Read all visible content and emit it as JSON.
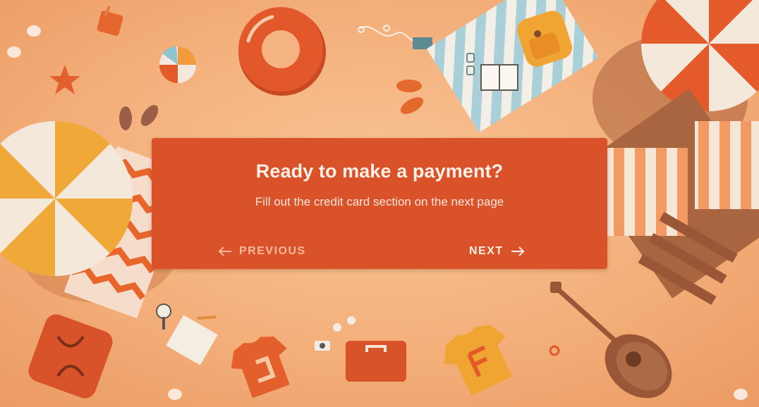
{
  "dialog": {
    "title": "Ready to make a payment?",
    "subtitle": "Fill out the credit card section on the next page",
    "previous_label": "PREVIOUS",
    "next_label": "NEXT"
  },
  "icons": {
    "previous": "arrow-left-icon",
    "next": "arrow-right-icon"
  },
  "colors": {
    "background_sand": "#f4b07e",
    "dialog_bg": "#d9522a",
    "title_text": "#fdf0e6",
    "previous_text": "#f6b99a"
  }
}
